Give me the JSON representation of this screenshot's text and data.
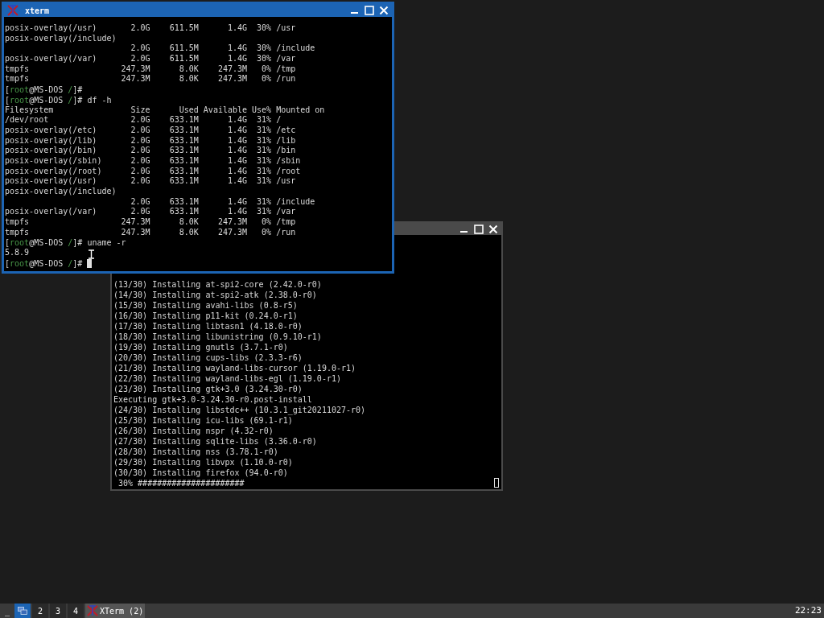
{
  "front_window": {
    "title": "xterm",
    "active": true,
    "lines": [
      {
        "kind": "output",
        "text": "posix-overlay(/usr)       2.0G    611.5M      1.4G  30% /usr"
      },
      {
        "kind": "output",
        "text": "posix-overlay(/include)"
      },
      {
        "kind": "output",
        "text": "                          2.0G    611.5M      1.4G  30% /include"
      },
      {
        "kind": "output",
        "text": "posix-overlay(/var)       2.0G    611.5M      1.4G  30% /var"
      },
      {
        "kind": "output",
        "text": "tmpfs                   247.3M      8.0K    247.3M   0% /tmp"
      },
      {
        "kind": "output",
        "text": "tmpfs                   247.3M      8.0K    247.3M   0% /run"
      },
      {
        "kind": "prompt",
        "open": "[",
        "user": "root",
        "host": "@MS-DOS ",
        "path": "/",
        "close": "]#",
        "cursor": false
      },
      {
        "kind": "prompt",
        "open": "[",
        "user": "root",
        "host": "@MS-DOS ",
        "path": "/",
        "close": "]# ",
        "command": "df -h",
        "cursor": false
      },
      {
        "kind": "output",
        "text": "Filesystem                Size      Used Available Use% Mounted on"
      },
      {
        "kind": "output",
        "text": "/dev/root                 2.0G    633.1M      1.4G  31% /"
      },
      {
        "kind": "output",
        "text": "posix-overlay(/etc)       2.0G    633.1M      1.4G  31% /etc"
      },
      {
        "kind": "output",
        "text": "posix-overlay(/lib)       2.0G    633.1M      1.4G  31% /lib"
      },
      {
        "kind": "output",
        "text": "posix-overlay(/bin)       2.0G    633.1M      1.4G  31% /bin"
      },
      {
        "kind": "output",
        "text": "posix-overlay(/sbin)      2.0G    633.1M      1.4G  31% /sbin"
      },
      {
        "kind": "output",
        "text": "posix-overlay(/root)      2.0G    633.1M      1.4G  31% /root"
      },
      {
        "kind": "output",
        "text": "posix-overlay(/usr)       2.0G    633.1M      1.4G  31% /usr"
      },
      {
        "kind": "output",
        "text": "posix-overlay(/include)"
      },
      {
        "kind": "output",
        "text": "                          2.0G    633.1M      1.4G  31% /include"
      },
      {
        "kind": "output",
        "text": "posix-overlay(/var)       2.0G    633.1M      1.4G  31% /var"
      },
      {
        "kind": "output",
        "text": "tmpfs                   247.3M      8.0K    247.3M   0% /tmp"
      },
      {
        "kind": "output",
        "text": "tmpfs                   247.3M      8.0K    247.3M   0% /run"
      },
      {
        "kind": "prompt",
        "open": "[",
        "user": "root",
        "host": "@MS-DOS ",
        "path": "/",
        "close": "]# ",
        "command": "uname -r",
        "cursor": false
      },
      {
        "kind": "output",
        "text": "5.8.9"
      },
      {
        "kind": "prompt",
        "open": "[",
        "user": "root",
        "host": "@MS-DOS ",
        "path": "/",
        "close": "]# ",
        "cursor": true
      }
    ]
  },
  "back_window": {
    "active": false,
    "lines": [
      "(13/30) Installing at-spi2-core (2.42.0-r0)",
      "(14/30) Installing at-spi2-atk (2.38.0-r0)",
      "(15/30) Installing avahi-libs (0.8-r5)",
      "(16/30) Installing p11-kit (0.24.0-r1)",
      "(17/30) Installing libtasn1 (4.18.0-r0)",
      "(18/30) Installing libunistring (0.9.10-r1)",
      "(19/30) Installing gnutls (3.7.1-r0)",
      "(20/30) Installing cups-libs (2.3.3-r6)",
      "(21/30) Installing wayland-libs-cursor (1.19.0-r1)",
      "(22/30) Installing wayland-libs-egl (1.19.0-r1)",
      "(23/30) Installing gtk+3.0 (3.24.30-r0)",
      "Executing gtk+3.0-3.24.30-r0.post-install",
      "(24/30) Installing libstdc++ (10.3.1_git20211027-r0)",
      "(25/30) Installing icu-libs (69.1-r1)",
      "(26/30) Installing nspr (4.32-r0)",
      "(27/30) Installing sqlite-libs (3.36.0-r0)",
      "(28/30) Installing nss (3.78.1-r0)",
      "(29/30) Installing libvpx (1.10.0-r0)",
      "(30/30) Installing firefox (94.0-r0)",
      " 30% ######################"
    ]
  },
  "taskbar": {
    "menu": "_",
    "workspaces": [
      {
        "kind": "icon",
        "selected": true
      },
      {
        "kind": "number",
        "label": "2",
        "selected": false
      },
      {
        "kind": "number",
        "label": "3",
        "selected": false
      },
      {
        "kind": "number",
        "label": "4",
        "selected": false
      }
    ],
    "tasks": [
      {
        "label": "XTerm (2)"
      }
    ],
    "clock": "22:23"
  }
}
